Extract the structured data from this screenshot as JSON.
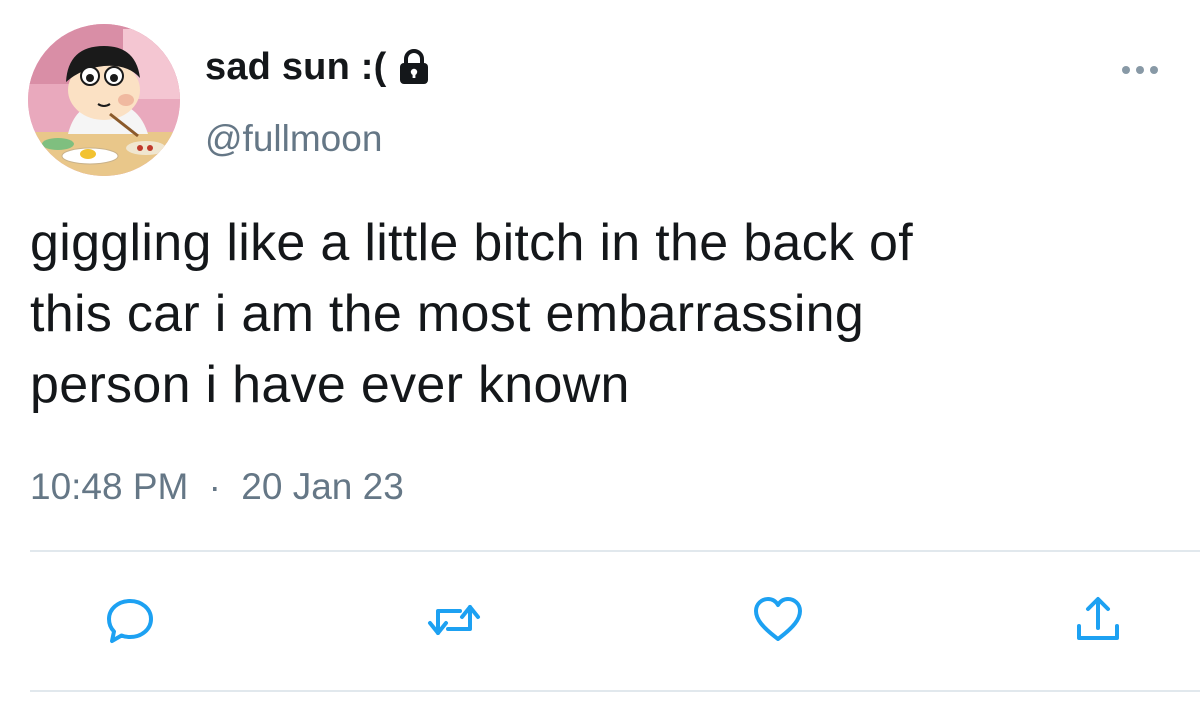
{
  "author": {
    "display_name": "sad sun :(",
    "handle": "@fullmoon",
    "protected": true
  },
  "tweet": {
    "text": "giggling like a little bitch in the back of\nthis car i am the most embarrassing\nperson i have ever known",
    "time": "10:48 PM",
    "separator": "·",
    "date": "20 Jan 23"
  },
  "icons": {
    "lock": "lock-icon",
    "more": "more-dots-icon",
    "reply": "reply-icon",
    "retweet": "retweet-icon",
    "like": "heart-icon",
    "share": "share-icon"
  },
  "colors": {
    "text": "#14171a",
    "secondary": "#657786",
    "icon": "#1da1f2",
    "divider": "#e1e8ed"
  }
}
